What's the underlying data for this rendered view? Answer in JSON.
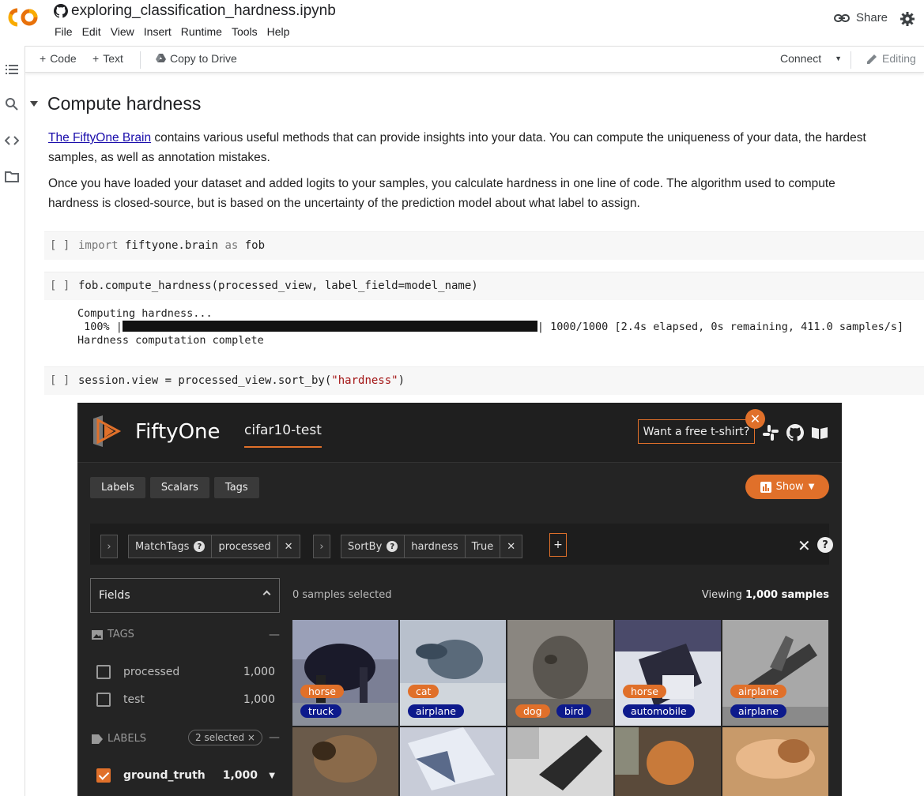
{
  "colab": {
    "notebook_title": "exploring_classification_hardness.ipynb",
    "menu": [
      "File",
      "Edit",
      "View",
      "Insert",
      "Runtime",
      "Tools",
      "Help"
    ],
    "share_label": "Share",
    "toolbar": {
      "code_label": "Code",
      "text_label": "Text",
      "copy_label": "Copy to Drive",
      "connect_label": "Connect",
      "editing_label": "Editing"
    }
  },
  "notebook": {
    "section_title": "Compute hardness",
    "para1_link": "The FiftyOne Brain",
    "para1_rest": " contains various useful methods that can provide insights into your data. You can compute the uniqueness of your data, the hardest samples, as well as annotation mistakes.",
    "para2": "Once you have loaded your dataset and added logits to your samples, you calculate hardness in one line of code. The algorithm used to compute hardness is closed-source, but is based on the uncertainty of the prediction model about what label to assign.",
    "cells": [
      {
        "bracket": "[ ]",
        "code_kw1": "import",
        "code_mid": " fiftyone.brain ",
        "code_kw2": "as",
        "code_end": " fob"
      },
      {
        "bracket": "[ ]",
        "code": "fob.compute_hardness(processed_view, label_field=model_name)"
      },
      {
        "bracket": "[ ]",
        "code_pre": "session.view = processed_view.sort_by(",
        "code_str": "\"hardness\"",
        "code_post": ")"
      }
    ],
    "output": {
      "line1": "Computing hardness...",
      "progress_prefix": " 100% |",
      "progress_value": 1.0,
      "progress_suffix": "| 1000/1000 [2.4s elapsed, 0s remaining, 411.0 samples/s]",
      "line3": "Hardness computation complete"
    }
  },
  "fiftyone": {
    "brand": "FiftyOne",
    "dataset": "cifar10-test",
    "tshirt_label": "Want a free t-shirt?",
    "tabs": [
      "Labels",
      "Scalars",
      "Tags"
    ],
    "show_label": "Show",
    "stage1": {
      "name": "MatchTags",
      "value": "processed"
    },
    "stage2": {
      "name": "SortBy",
      "value": "hardness",
      "value2": "True"
    },
    "plus": "+",
    "fields_label": "Fields",
    "tags_header": "TAGS",
    "tags": [
      {
        "label": "processed",
        "count": "1,000"
      },
      {
        "label": "test",
        "count": "1,000"
      }
    ],
    "labels_header": "LABELS",
    "labels_selected": "2 selected",
    "labels": [
      {
        "label": "ground_truth",
        "count": "1,000"
      }
    ],
    "samples_selected": "0 samples selected",
    "viewing_prefix": "Viewing ",
    "viewing_count": "1,000 samples",
    "colors": {
      "accent": "#e0702a",
      "prediction": "#0d1a8c",
      "bg": "#242424"
    },
    "tiles": [
      {
        "gt": "horse",
        "pred": "truck"
      },
      {
        "gt": "cat",
        "pred": "airplane"
      },
      {
        "gt": "dog",
        "pred": "bird"
      },
      {
        "gt": "horse",
        "pred": "automobile"
      },
      {
        "gt": "airplane",
        "pred": "airplane"
      }
    ]
  }
}
